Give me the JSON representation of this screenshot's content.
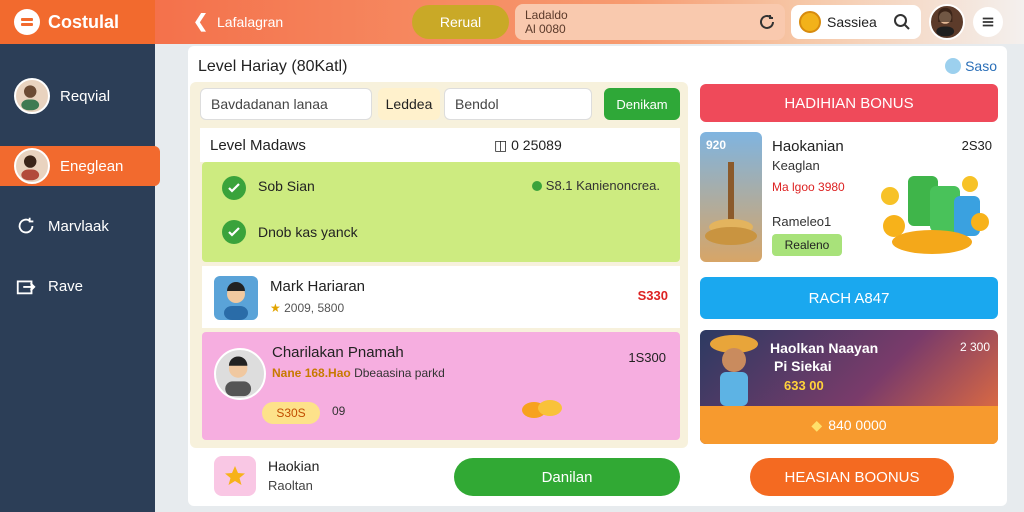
{
  "brand": {
    "name": "Costulal"
  },
  "sidebar": {
    "items": [
      {
        "label": "Reqvial",
        "icon": "avatar"
      },
      {
        "label": "Eneglean",
        "icon": "avatar"
      },
      {
        "label": "Marvlaak",
        "icon": "refresh-icon"
      },
      {
        "label": "Rave",
        "icon": "export-icon"
      }
    ]
  },
  "topbar": {
    "title": "Lafalagran",
    "reward_label": "Rerual",
    "info_line1": "Ladaldo",
    "info_line2": "Al 0080",
    "user_name": "Sassiea"
  },
  "main": {
    "title": "Level Hariay (80Katl)",
    "save_link": "Saso",
    "search_value": "Bavdadanan lanaa",
    "sort_label": "Leddea",
    "filter_value": "Bendol",
    "action_label": "Denikam",
    "list_header": "Level Madaws",
    "list_header_amount": "0 25089",
    "green_rows": [
      {
        "text": "Sob Sian"
      },
      {
        "text": "Dnob kas yanck"
      }
    ],
    "green_note": "S8.1 Kanienoncrea.",
    "person": {
      "name": "Mark Hariaran",
      "sub": "2009, 5800",
      "amount": "S330"
    },
    "pink": {
      "title": "Charilakan Pnamah",
      "sub_prefix": "Nane",
      "sub_highlight": "168.Hao",
      "sub_rest": "Dbeaasina parkd",
      "amount": "1S300",
      "chip": "S30S",
      "extra": "09"
    },
    "bottom": {
      "title": "Haokian",
      "sub": "Raoltan",
      "button": "Danilan"
    }
  },
  "right": {
    "bonus_banner": "HADIHIAN BONUS",
    "promo": {
      "tag": "920",
      "title": "Haokanian",
      "sub": "Keaglan",
      "red": "Ma lgoo 3980",
      "label": "Rameleo1",
      "button": "Realeno",
      "amount": "2S30"
    },
    "blue_button": "RACH A847",
    "game": {
      "title": "Haolkan Naayan",
      "sub": "Pi Siekai",
      "amount": "633 00",
      "corner": "2 300",
      "bottom_amount": "840 0000"
    },
    "orange_button": "HEASIAN BOONUS"
  },
  "colors": {
    "accent": "#f26a2e",
    "sidebar": "#2c3e57",
    "green": "#31a934",
    "pink": "#f6aee0",
    "blue": "#1aa8ef",
    "red": "#ef4a5a"
  }
}
